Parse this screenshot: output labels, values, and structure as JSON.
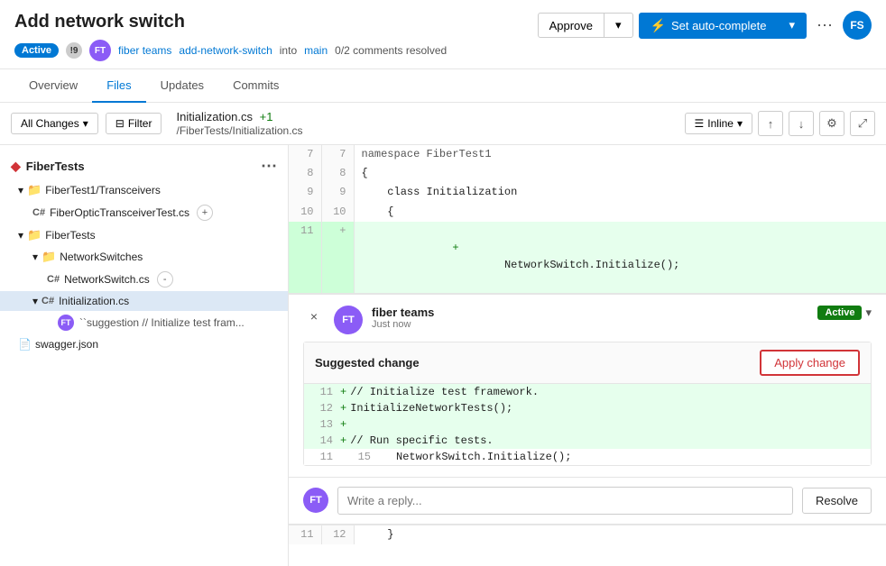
{
  "header": {
    "title": "Add network switch",
    "badge": "Active",
    "notification_count": "!9",
    "author": "fiber teams",
    "branch_from": "add-network-switch",
    "branch_into": "main",
    "comments": "0/2 comments resolved",
    "approve_label": "Approve",
    "autocomplete_label": "Set auto-complete",
    "user_initials": "FS"
  },
  "tabs": [
    {
      "label": "Overview",
      "active": false
    },
    {
      "label": "Files",
      "active": true
    },
    {
      "label": "Updates",
      "active": false
    },
    {
      "label": "Commits",
      "active": false
    }
  ],
  "toolbar": {
    "all_changes_label": "All Changes",
    "filter_label": "Filter",
    "filename": "Initialization.cs",
    "added_count": "+1",
    "filepath": "/FiberTests/Initialization.cs",
    "inline_label": "Inline"
  },
  "sidebar": {
    "title": "FiberTests",
    "items": [
      {
        "label": "FiberTest1/Transceivers",
        "type": "folder",
        "indent": 1,
        "expanded": true
      },
      {
        "label": "FiberOpticTransceiverTest.cs",
        "type": "csharp",
        "indent": 2
      },
      {
        "label": "FiberTests",
        "type": "folder",
        "indent": 1,
        "expanded": true
      },
      {
        "label": "NetworkSwitches",
        "type": "folder",
        "indent": 2,
        "expanded": true
      },
      {
        "label": "NetworkSwitch.cs",
        "type": "csharp",
        "indent": 3
      },
      {
        "label": "Initialization.cs",
        "type": "csharp",
        "indent": 2,
        "selected": true
      },
      {
        "label": "``suggestion // Initialize test fram...",
        "type": "suggestion",
        "indent": 3
      },
      {
        "label": "swagger.json",
        "type": "json",
        "indent": 1
      }
    ]
  },
  "code_lines": [
    {
      "left_num": "7",
      "right_num": "7",
      "code": "namespace FiberTest1",
      "added": false
    },
    {
      "left_num": "8",
      "right_num": "8",
      "code": "{",
      "added": false
    },
    {
      "left_num": "9",
      "right_num": "9",
      "code": "    class Initialization",
      "added": false
    },
    {
      "left_num": "10",
      "right_num": "10",
      "code": "    {",
      "added": false
    },
    {
      "left_num": "11",
      "right_num": "+",
      "code": "        NetworkSwitch.Initialize();",
      "added": true
    }
  ],
  "comment": {
    "avatar": "FT",
    "username": "fiber teams",
    "time": "Just now",
    "status": "Active",
    "close_btn": "×",
    "suggestion_title": "Suggested change",
    "apply_change_label": "Apply change",
    "suggestion_lines": [
      {
        "num1": "11",
        "num2": "+",
        "code": "        // Initialize test framework.",
        "added": true
      },
      {
        "num1": "12",
        "num2": "+",
        "code": "        InitializeNetworkTests();",
        "added": true
      },
      {
        "num1": "13",
        "num2": "+",
        "code": "",
        "added": true
      },
      {
        "num1": "14",
        "num2": "+",
        "code": "        // Run specific tests.",
        "added": true
      },
      {
        "num1": "11",
        "num2": "15",
        "code": "        NetworkSwitch.Initialize();",
        "added": false
      }
    ],
    "reply_placeholder": "Write a reply...",
    "resolve_label": "Resolve"
  },
  "bottom_code": [
    {
      "left_num": "11",
      "right_num": "12",
      "code": "    }"
    }
  ]
}
